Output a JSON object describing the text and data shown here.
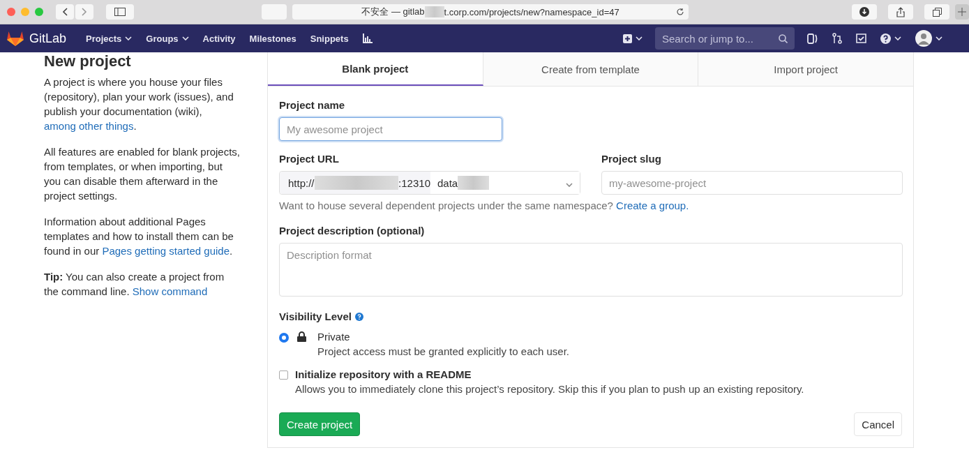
{
  "browser": {
    "address_prefix": "不安全 — gitlab",
    "address_suffix": "t.corp.com/projects/new?namespace_id=47"
  },
  "navbar": {
    "logo_text": "GitLab",
    "items": [
      {
        "label": "Projects",
        "dropdown": true
      },
      {
        "label": "Groups",
        "dropdown": true
      },
      {
        "label": "Activity",
        "dropdown": false
      },
      {
        "label": "Milestones",
        "dropdown": false
      },
      {
        "label": "Snippets",
        "dropdown": false
      }
    ],
    "search": {
      "placeholder": "Search or jump to..."
    }
  },
  "sidebar": {
    "title": "New project",
    "paragraphs": [
      [
        {
          "text": "A project is where you house your files (repository), plan your work (issues), and publish your documentation (wiki), ",
          "kind": "plain"
        },
        {
          "text": "among other things",
          "kind": "link"
        },
        {
          "text": ".",
          "kind": "plain"
        }
      ],
      [
        {
          "text": "All features are enabled for blank projects, from templates, or when importing, but you can disable them afterward in the project settings.",
          "kind": "plain"
        }
      ],
      [
        {
          "text": "Information about additional Pages templates and how to install them can be found in our ",
          "kind": "plain"
        },
        {
          "text": "Pages getting started guide",
          "kind": "link"
        },
        {
          "text": ".",
          "kind": "plain"
        }
      ],
      [
        {
          "text": "Tip:",
          "kind": "bold"
        },
        {
          "text": " You can also create a project from the command line. ",
          "kind": "plain"
        },
        {
          "text": "Show command",
          "kind": "link"
        }
      ]
    ]
  },
  "tabs": [
    {
      "label": "Blank project",
      "selected": true
    },
    {
      "label": "Create from template",
      "selected": false
    },
    {
      "label": "Import project",
      "selected": false
    }
  ],
  "form": {
    "name_label": "Project name",
    "name_placeholder": "My awesome project",
    "url_label": "Project URL",
    "url_prefix": "http://",
    "url_port": ":12310",
    "namespace": "data",
    "slug_label": "Project slug",
    "slug_placeholder": "my-awesome-project",
    "group_hint": "Want to house several dependent projects under the same namespace?",
    "group_link": "Create a group.",
    "description_label": "Project description (optional)",
    "description_placeholder": "Description format",
    "visibility_label": "Visibility Level",
    "visibility_options": [
      {
        "label": "Private",
        "description": "Project access must be granted explicitly to each user.",
        "selected": true
      }
    ],
    "readme": {
      "label": "Initialize repository with a README",
      "description": "Allows you to immediately clone this project’s repository. Skip this if you plan to push up an existing repository.",
      "checked": false
    },
    "submit": "Create project",
    "cancel": "Cancel"
  }
}
